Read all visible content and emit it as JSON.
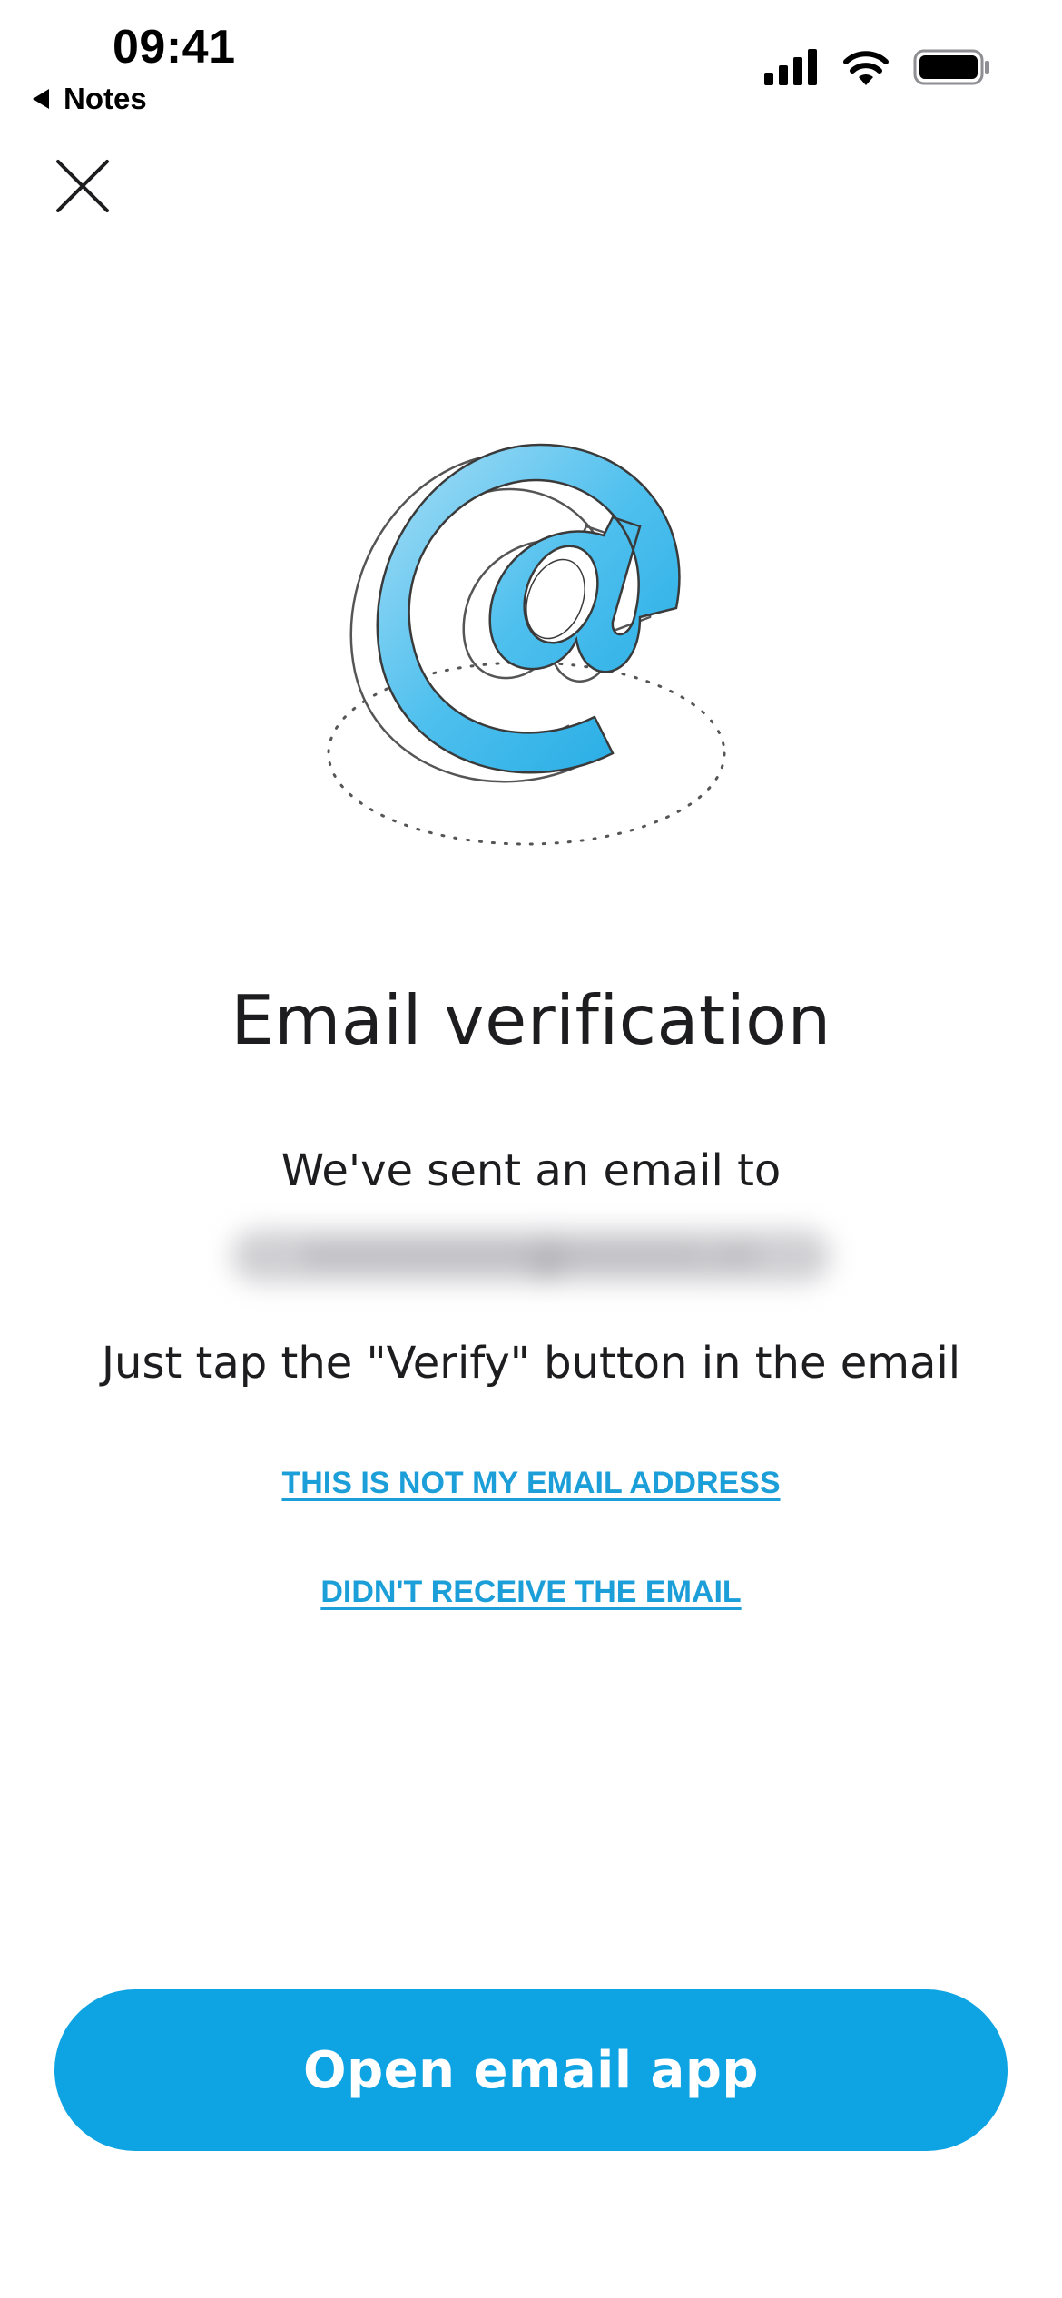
{
  "status_bar": {
    "time": "09:41",
    "back_app": "Notes",
    "icons": [
      "cellular-signal-icon",
      "wifi-icon",
      "battery-icon"
    ]
  },
  "header": {
    "close_icon": "close-icon"
  },
  "illustration": {
    "icon": "at-sign-illustration",
    "color": "#35b5ea"
  },
  "main": {
    "title": "Email verification",
    "sent_line": "We've sent an email to",
    "email_redacted": "••••••••••@••••••.••",
    "instruction": "Just tap the \"Verify\" button in the email",
    "link_not_my_email": "THIS IS NOT MY EMAIL ADDRESS",
    "link_didnt_receive": "DIDN'T RECEIVE THE EMAIL"
  },
  "footer": {
    "open_email_button": "Open email app"
  },
  "colors": {
    "accent": "#0ea3e2",
    "link": "#1c9fd8",
    "text": "#1d1d1f"
  }
}
